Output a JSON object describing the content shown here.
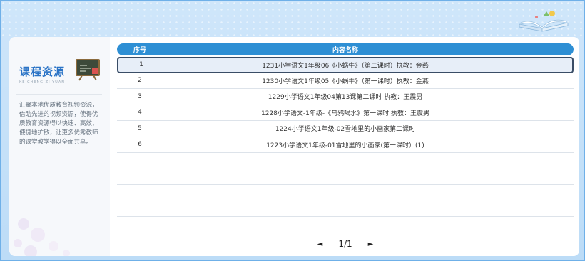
{
  "sidebar": {
    "title": "课程资源",
    "subtitle": "KE CHENG ZI YUAN",
    "description": "汇聚本地优质教育视频资源，借助先进的视频资源，使得优质教育资源得以快速、高效、便捷地扩散，让更多优秀教师的课堂教学得以全面共享。"
  },
  "table": {
    "headers": {
      "index": "序号",
      "name": "内容名称"
    },
    "rows": [
      {
        "index": "1",
        "name": "1231小学语文1年级06《小蜗牛》（第二课时）执教：金燕"
      },
      {
        "index": "2",
        "name": "1230小学语文1年级05《小蜗牛》（第一课时）执教：金燕"
      },
      {
        "index": "3",
        "name": "1229小学语文1年级04第13课第二课时 执教：王震男"
      },
      {
        "index": "4",
        "name": "1228小学语文-1年级-《乌鸦喝水》第一课时 执教：王震男"
      },
      {
        "index": "5",
        "name": "1224小学语文1年级-02雪地里的小画家第二课时"
      },
      {
        "index": "6",
        "name": "1223小学语文1年级-01雪地里的小画家(第一课时）(1)"
      }
    ]
  },
  "pager": {
    "prev": "◄",
    "page": "1/1",
    "next": "►"
  }
}
